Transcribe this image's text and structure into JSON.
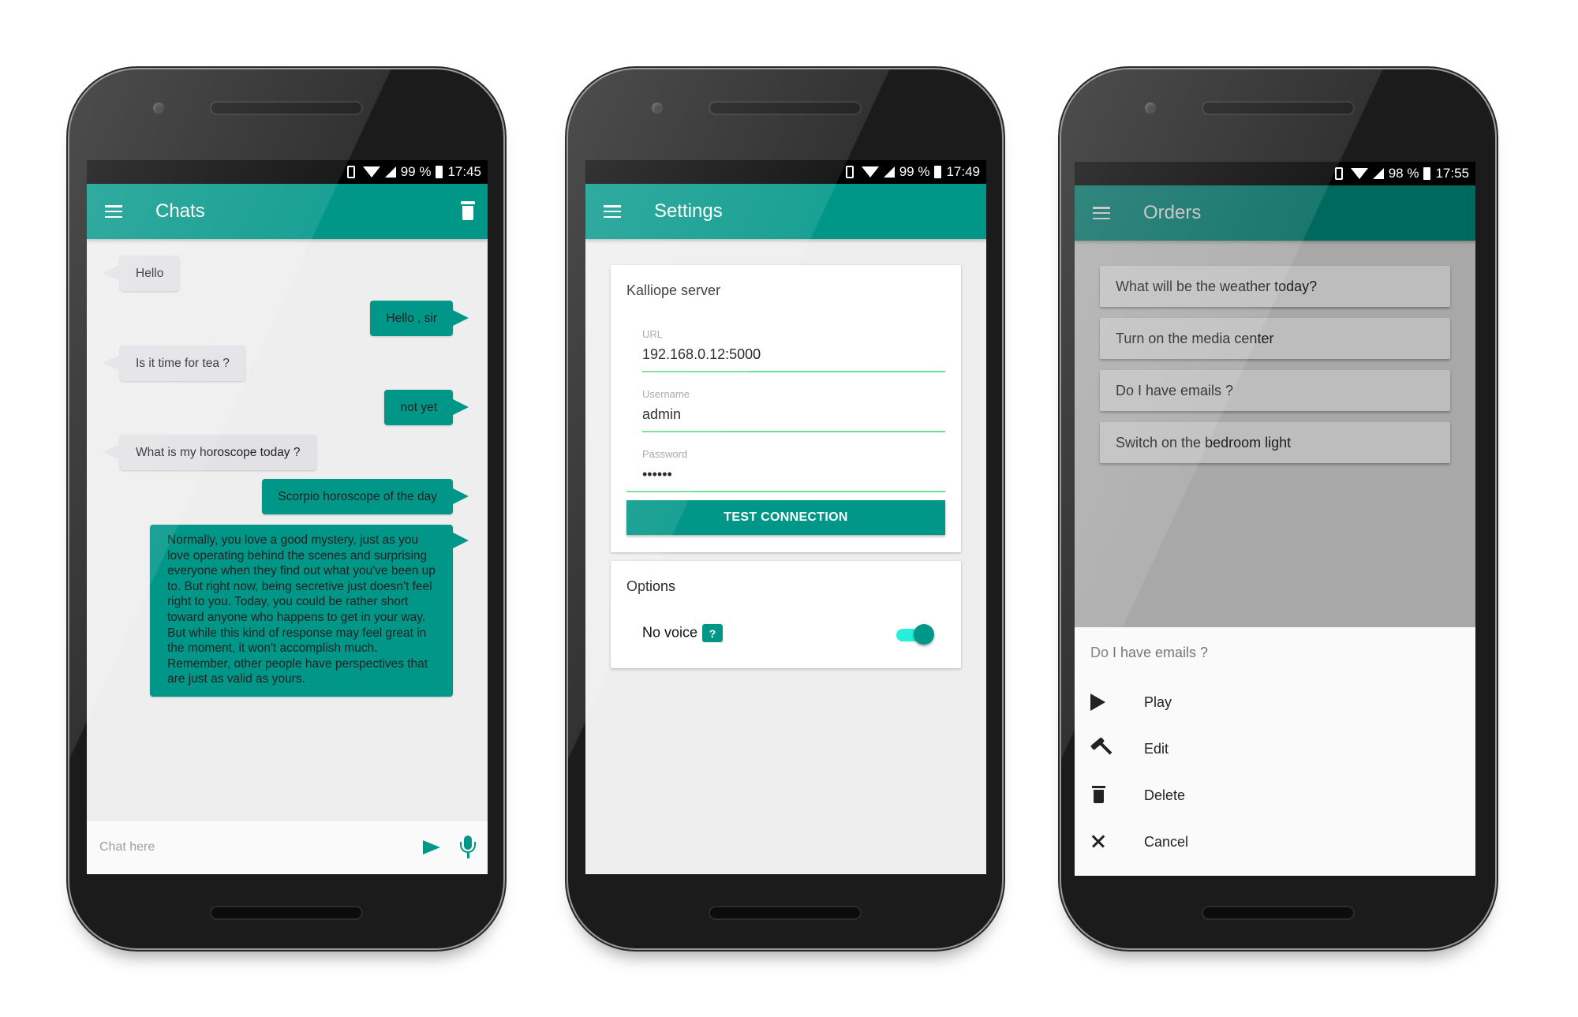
{
  "status_icons": [
    "vibrate-icon",
    "wifi-icon",
    "signal-icon",
    "battery-icon"
  ],
  "phones": {
    "chats": {
      "status": {
        "battery": "99 %",
        "time": "17:45"
      },
      "appbar": {
        "title": "Chats",
        "menu_icon": "hamburger-icon",
        "action_icon": "trash-icon"
      },
      "messages": [
        {
          "from": "user",
          "text": "Hello"
        },
        {
          "from": "bot",
          "text": "Hello , sir"
        },
        {
          "from": "user",
          "text": "Is it time for tea ?"
        },
        {
          "from": "bot",
          "text": "not yet"
        },
        {
          "from": "user",
          "text": "What is my horoscope today ?"
        },
        {
          "from": "bot",
          "text": "Scorpio horoscope of the day"
        },
        {
          "from": "bot",
          "text": "Normally, you love a good mystery, just as you love operating behind the scenes and surprising everyone when they find out what you've been up to. But right now, being secretive just doesn't feel right to you. Today, you could be rather short toward anyone who happens to get in your way. But while this kind of response may feel great in the moment, it won't accomplish much. Remember, other people have perspectives that are just as valid as yours."
        }
      ],
      "input": {
        "placeholder": "Chat here",
        "value": ""
      },
      "colors": {
        "accent": "#009688",
        "incoming_bubble": "#e2e2e6"
      }
    },
    "settings": {
      "status": {
        "battery": "99 %",
        "time": "17:49"
      },
      "appbar": {
        "title": "Settings"
      },
      "server_card": {
        "title": "Kalliope server",
        "fields": [
          {
            "label": "URL",
            "value": "192.168.0.12:5000"
          },
          {
            "label": "Username",
            "value": "admin"
          },
          {
            "label": "Password",
            "value": "••••••"
          }
        ],
        "button": "TEST CONNECTION"
      },
      "options_card": {
        "title": "Options",
        "no_voice_label": "No voice",
        "help_badge": "?",
        "no_voice_enabled": true
      }
    },
    "orders": {
      "status": {
        "battery": "98 %",
        "time": "17:55"
      },
      "appbar": {
        "title": "Orders"
      },
      "items": [
        "What will be the weather today?",
        "Turn on the media center",
        "Do I have emails ?",
        "Switch on the bedroom light"
      ],
      "sheet": {
        "title": "Do I have emails ?",
        "actions": [
          {
            "label": "Play",
            "icon": "play-icon"
          },
          {
            "label": "Edit",
            "icon": "hammer-icon"
          },
          {
            "label": "Delete",
            "icon": "trash-icon"
          },
          {
            "label": "Cancel",
            "icon": "close-icon"
          }
        ]
      }
    }
  }
}
